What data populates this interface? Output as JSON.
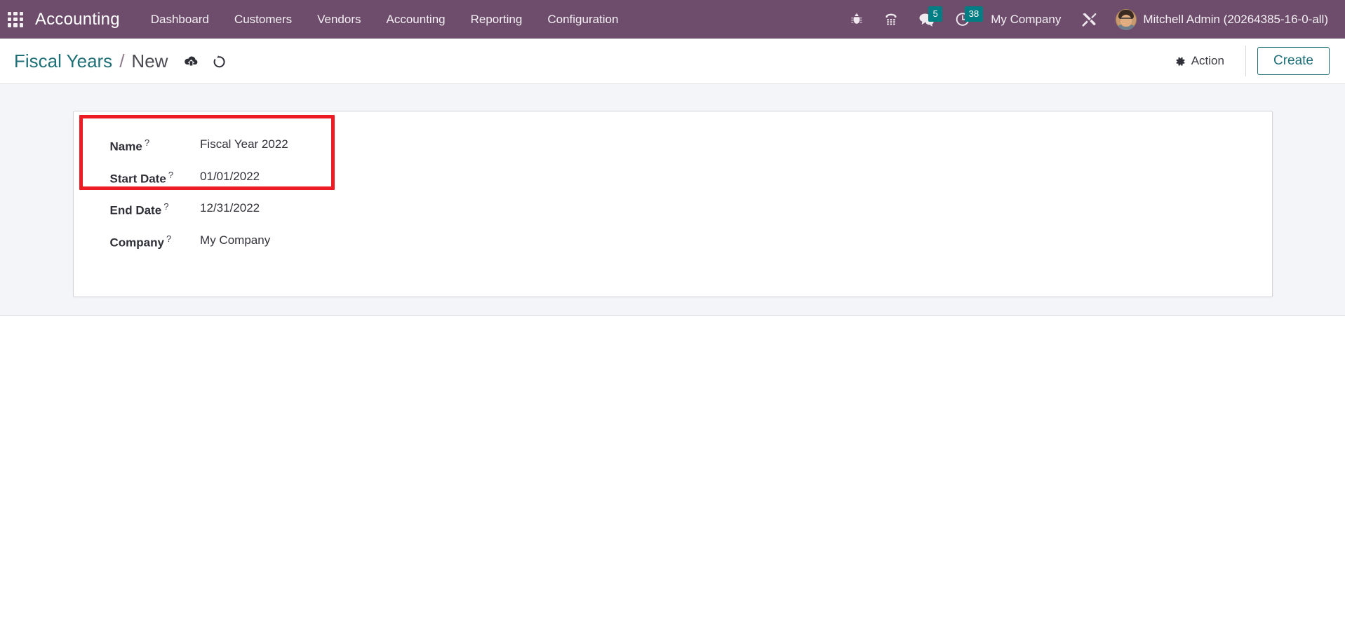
{
  "navbar": {
    "apps_icon": "apps-grid-icon",
    "brand": "Accounting",
    "menu_items": [
      {
        "label": "Dashboard",
        "name": "menu-dashboard"
      },
      {
        "label": "Customers",
        "name": "menu-customers"
      },
      {
        "label": "Vendors",
        "name": "menu-vendors"
      },
      {
        "label": "Accounting",
        "name": "menu-accounting"
      },
      {
        "label": "Reporting",
        "name": "menu-reporting"
      },
      {
        "label": "Configuration",
        "name": "menu-configuration"
      }
    ],
    "icons": {
      "bug": "bug-icon",
      "phone": "phone-dialpad-icon",
      "messages": "chat-bubble-icon",
      "activities": "clock-icon",
      "tools": "tools-icon"
    },
    "messages_count": "5",
    "activities_count": "38",
    "company": "My Company",
    "user": "Mitchell Admin (20264385-16-0-all)",
    "badge_color": "#017e84",
    "background_color": "#6d4d6b"
  },
  "control_panel": {
    "breadcrumb_parent": "Fiscal Years",
    "breadcrumb_separator": "/",
    "breadcrumb_current": "New",
    "save_icon": "cloud-upload-icon",
    "discard_icon": "undo-icon",
    "action_label": "Action",
    "action_icon": "gear-icon",
    "create_label": "Create",
    "accent_color": "#1f6f77"
  },
  "form": {
    "fields": [
      {
        "label": "Name",
        "value": "Fiscal Year 2022",
        "tooltip": "?",
        "name": "name"
      },
      {
        "label": "Start Date",
        "value": "01/01/2022",
        "tooltip": "?",
        "name": "start-date"
      },
      {
        "label": "End Date",
        "value": "12/31/2022",
        "tooltip": "?",
        "name": "end-date"
      },
      {
        "label": "Company",
        "value": "My Company",
        "tooltip": "?",
        "name": "company"
      }
    ]
  },
  "annotation": {
    "highlight_color": "#ed1c24",
    "covers": "Name and Start Date fields"
  }
}
